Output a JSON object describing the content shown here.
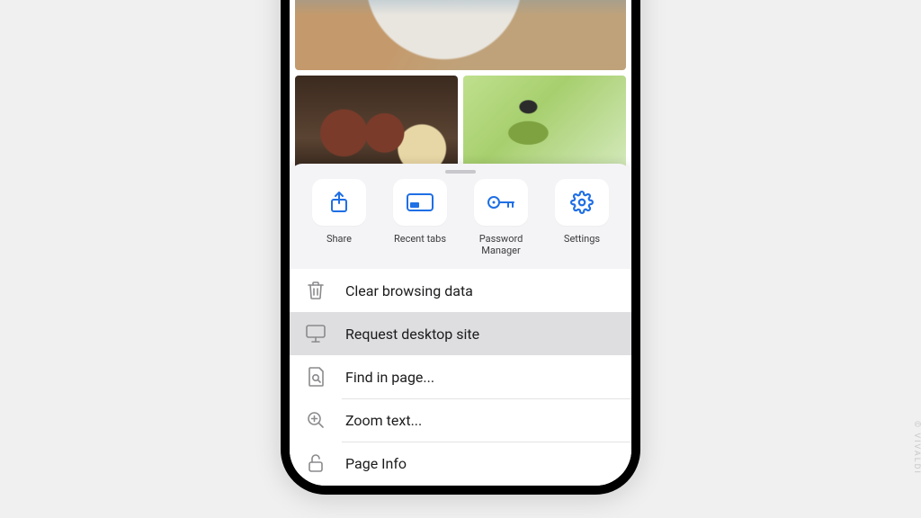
{
  "quick_actions": {
    "share": {
      "label": "Share"
    },
    "recent": {
      "label": "Recent tabs"
    },
    "password": {
      "label": "Password Manager"
    },
    "settings": {
      "label": "Settings"
    }
  },
  "menu": {
    "clear": {
      "label": "Clear browsing data"
    },
    "desktop": {
      "label": "Request desktop site"
    },
    "find": {
      "label": "Find in page..."
    },
    "zoom": {
      "label": "Zoom text..."
    },
    "pageinfo": {
      "label": "Page Info"
    }
  },
  "watermark": "© VIVALDI",
  "colors": {
    "accent": "#1f6fe5",
    "icon_muted": "#8a8a8d"
  }
}
